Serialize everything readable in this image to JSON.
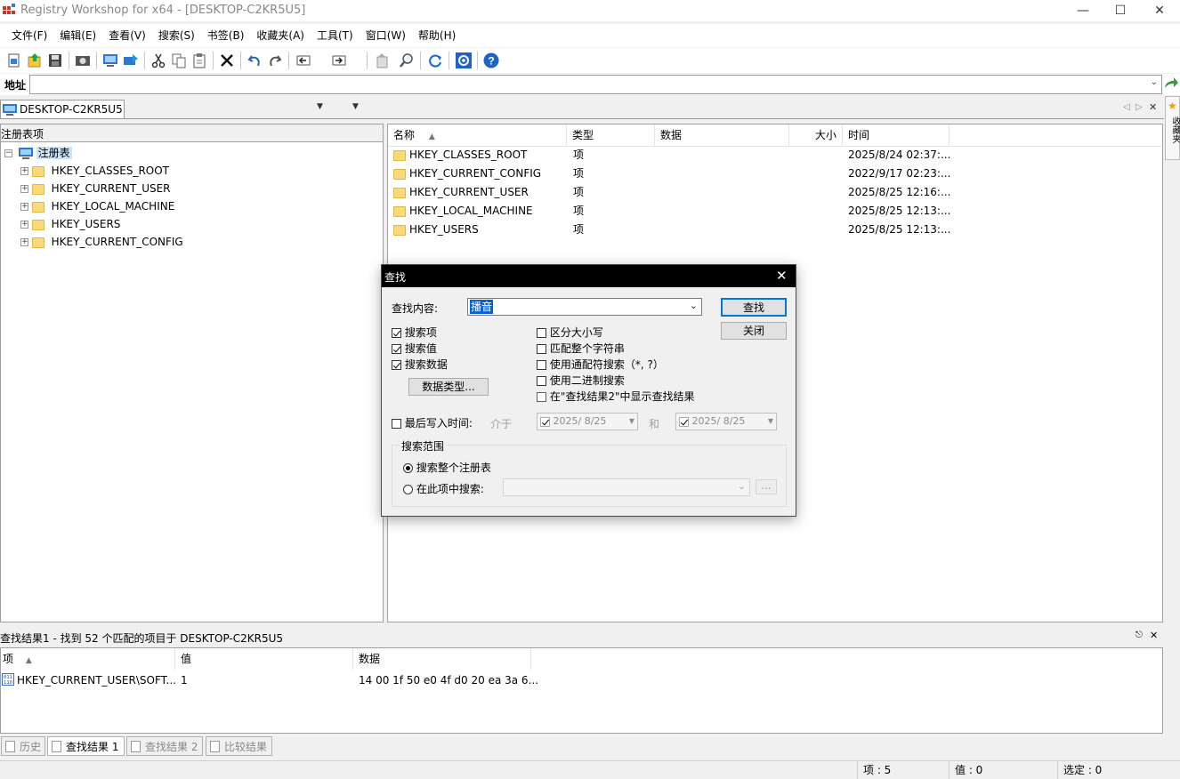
{
  "window": {
    "title": "Registry Workshop for x64 - [DESKTOP-C2KR5U5]"
  },
  "menu": [
    "文件(F)",
    "编辑(E)",
    "查看(V)",
    "搜索(S)",
    "书签(B)",
    "收藏夹(A)",
    "工具(T)",
    "窗口(W)",
    "帮助(H)"
  ],
  "address": {
    "label": "地址",
    "value": ""
  },
  "tabs": {
    "main": "DESKTOP-C2KR5U5",
    "favorites": "收藏夹"
  },
  "tree": {
    "header": "注册表项",
    "root": "注册表",
    "items": [
      "HKEY_CLASSES_ROOT",
      "HKEY_CURRENT_USER",
      "HKEY_LOCAL_MACHINE",
      "HKEY_USERS",
      "HKEY_CURRENT_CONFIG"
    ]
  },
  "list": {
    "columns": [
      "名称",
      "类型",
      "数据",
      "大小",
      "时间"
    ],
    "rows": [
      {
        "name": "HKEY_CLASSES_ROOT",
        "type": "项",
        "time": "2025/8/24 02:37:..."
      },
      {
        "name": "HKEY_CURRENT_CONFIG",
        "type": "项",
        "time": "2022/9/17 02:23:..."
      },
      {
        "name": "HKEY_CURRENT_USER",
        "type": "项",
        "time": "2025/8/25 12:16:..."
      },
      {
        "name": "HKEY_LOCAL_MACHINE",
        "type": "项",
        "time": "2025/8/25 12:13:..."
      },
      {
        "name": "HKEY_USERS",
        "type": "项",
        "time": "2025/8/25 12:13:..."
      }
    ]
  },
  "dialog": {
    "title": "查找",
    "search_label": "查找内容:",
    "search_value": "播音",
    "find_button": "查找",
    "close_button": "关闭",
    "left_options": [
      {
        "label": "搜索项",
        "checked": true
      },
      {
        "label": "搜索值",
        "checked": true
      },
      {
        "label": "搜索数据",
        "checked": true
      }
    ],
    "right_options": [
      {
        "label": "区分大小写",
        "checked": false
      },
      {
        "label": "匹配整个字符串",
        "checked": false
      },
      {
        "label": "使用通配符搜索（*, ?）",
        "checked": false
      },
      {
        "label": "使用二进制搜索",
        "checked": false
      },
      {
        "label": "在\"查找结果2\"中显示查找结果",
        "checked": false
      }
    ],
    "data_types_button": "数据类型...",
    "last_write_label": "最后写入时间:",
    "between": "介于",
    "and": "和",
    "date_from": "2025/ 8/25",
    "date_to": "2025/ 8/25",
    "scope_title": "搜索范围",
    "scope_all": "搜索整个注册表",
    "scope_key": "在此项中搜索:",
    "browse": "..."
  },
  "results": {
    "header": "查找结果1 - 找到 52 个匹配的项目于 DESKTOP-C2KR5U5",
    "columns": [
      "项",
      "值",
      "数据"
    ],
    "rows": [
      {
        "key": "HKEY_CURRENT_USER\\SOFT...",
        "value": "1",
        "data": "14 00 1f 50 e0 4f d0 20 ea 3a 6..."
      }
    ]
  },
  "bottom_tabs": [
    "历史",
    "查找结果 1",
    "查找结果 2",
    "比较结果"
  ],
  "status": {
    "items": "项 : 5",
    "values": "值 : 0",
    "selected": "选定 : 0"
  },
  "colors": {
    "accent": "#0078d7",
    "folder": "#f9d97a",
    "selection": "#0a64c8"
  }
}
